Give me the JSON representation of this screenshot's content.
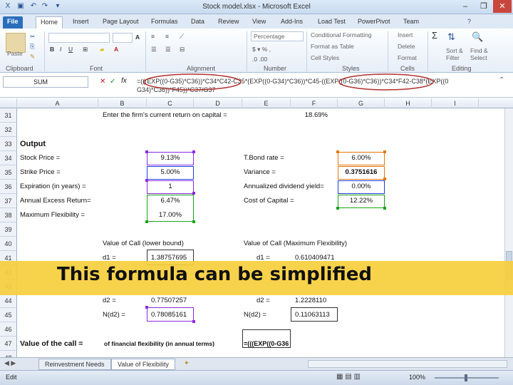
{
  "window": {
    "title": "Stock model.xlsx - Microsoft Excel"
  },
  "ribbon_tabs": [
    "File",
    "Home",
    "Insert",
    "Page Layout",
    "Formulas",
    "Data",
    "Review",
    "View",
    "Add-Ins",
    "Load Test",
    "PowerPivot",
    "Team"
  ],
  "ribbon": {
    "clipboard": {
      "paste": "Paste",
      "label": "Clipboard"
    },
    "font": {
      "label": "Font"
    },
    "number": {
      "format": "Percentage",
      "label": "Number"
    },
    "alignment": {
      "label": "Alignment"
    },
    "styles": {
      "cond": "Conditional Formatting",
      "table": "Format as Table",
      "cell": "Cell Styles",
      "label": "Styles"
    },
    "cells": {
      "insert": "Insert",
      "delete": "Delete",
      "format": "Format",
      "label": "Cells"
    },
    "editing": {
      "sigma": "Σ",
      "sort": "Sort &",
      "filter": "Filter",
      "find": "Find &",
      "select": "Select",
      "label": "Editing"
    }
  },
  "formula_bar": {
    "name_box": "SUM",
    "fx": "fx",
    "line1": "=(((EXP((0-G35)*C36))*C34*C42-C35*(EXP((0-G34)*C36))*C45-((EXP((0-G36)*C36))*C34*F42-C38*(EXP((0",
    "line2": "G34)*C36))*F45))*C37/G37"
  },
  "columns": [
    "A",
    "B",
    "C",
    "D",
    "E",
    "F",
    "G",
    "H",
    "I"
  ],
  "rows": {
    "r31": {
      "num": "31",
      "label": "Enter the firm's current return on capital =",
      "value": "18.69%"
    },
    "r32": {
      "num": "32"
    },
    "r33": {
      "num": "33",
      "label": "Output"
    },
    "r34": {
      "num": "34",
      "label": "Stock Price =",
      "value": "9.13%",
      "label2": "T.Bond rate =",
      "value2": "6.00%"
    },
    "r35": {
      "num": "35",
      "label": "Strike Price =",
      "value": "5.00%",
      "label2": "Variance =",
      "value2": "0.3751616"
    },
    "r36": {
      "num": "36",
      "label": "Expiration (in years) =",
      "value": "1",
      "label2": "Annualized dividend yield=",
      "value2": "0.00%"
    },
    "r37": {
      "num": "37",
      "label": "Annual Excess Return=",
      "value": "6.47%",
      "label2": "Cost of Capital =",
      "value2": "12.22%"
    },
    "r38": {
      "num": "38",
      "label": "Maximum Flexibility =",
      "value": "17.00%"
    },
    "r39": {
      "num": "39"
    },
    "r40": {
      "num": "40",
      "label": "Value of Call (lower bound)",
      "label2": "Value of Call (Maximum Flexibility)"
    },
    "r41": {
      "num": "41",
      "label": "d1 =",
      "value": "1.38757695",
      "label2": "d1 =",
      "value2": "0.610409471"
    },
    "r42": {
      "num": "42"
    },
    "r43": {
      "num": "43"
    },
    "r44": {
      "num": "44",
      "label": "d2 =",
      "value": "0.77507257",
      "label2": "d2 =",
      "value2": "1.2228110"
    },
    "r45": {
      "num": "45",
      "label": "N(d2) =",
      "value": "0.78085161",
      "label2": "N(d2) =",
      "value2": "0.11063113"
    },
    "r46": {
      "num": "46"
    },
    "r47": {
      "num": "47",
      "label": "Value of the call =",
      "note": "of financial flexibility (in annual terms)",
      "value": "=(((EXP((0-G36"
    },
    "r48": {
      "num": "48"
    }
  },
  "banner": "This formula can be simplified",
  "sheet_tabs": [
    "Reinvestment Needs",
    "Value of Flexibility"
  ],
  "status": {
    "mode": "Edit",
    "zoom": "100%"
  },
  "colors": {
    "purple": "#8a2be2",
    "green": "#1aa31a",
    "blue": "#1f3fd6",
    "orange": "#e07a10",
    "red_circle": "#b03030",
    "banner": "#f6ce3c"
  }
}
